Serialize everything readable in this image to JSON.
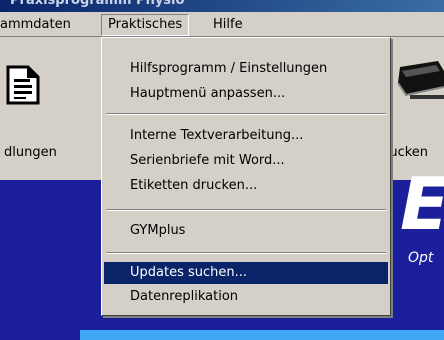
{
  "window": {
    "title": "Praxisprogramm Physio"
  },
  "menubar": {
    "stammdaten": "ammdaten",
    "praktisches": "Praktisches",
    "hilfe": "Hilfe"
  },
  "toolbar": {
    "left_label": "dlungen",
    "right_label": "rucken"
  },
  "dropdown": {
    "items": [
      "Hilfsprogramm / Einstellungen",
      "Hauptmenü anpassen...",
      "Interne Textverarbeitung...",
      "Serienbriefe mit Word...",
      "Etiketten drucken...",
      "GYMplus",
      "Updates suchen...",
      "Datenreplikation"
    ],
    "highlighted": "Updates suchen..."
  },
  "content": {
    "big_letter": "E",
    "subtitle": "Opt"
  }
}
